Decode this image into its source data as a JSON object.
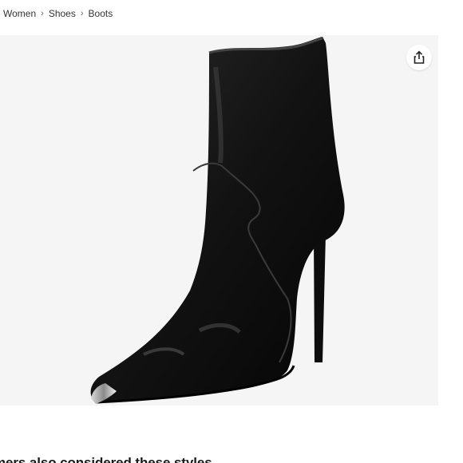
{
  "breadcrumb": {
    "items": [
      {
        "label": "Women"
      },
      {
        "label": "Shoes"
      },
      {
        "label": "Boots"
      }
    ],
    "separator": "›"
  },
  "product": {
    "image_icon": "share-icon",
    "background_color": "#f5f5f5"
  },
  "recommendations": {
    "heading": "mers also considered these styles"
  }
}
